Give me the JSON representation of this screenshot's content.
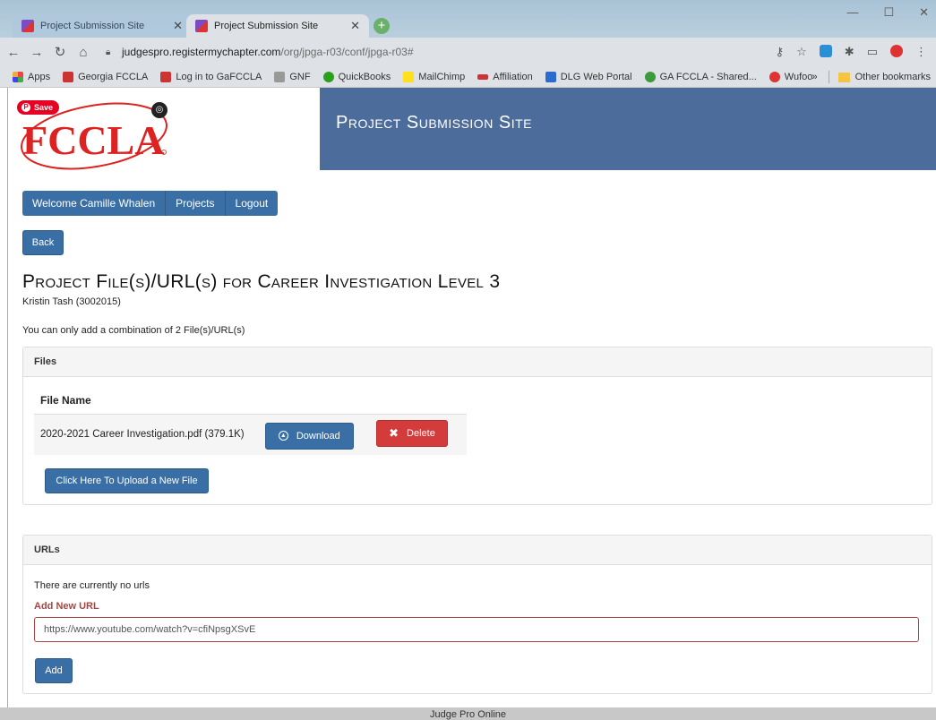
{
  "browser": {
    "tabs": [
      {
        "title": "Project Submission Site",
        "active": false
      },
      {
        "title": "Project Submission Site",
        "active": true
      }
    ],
    "new_tab": "+",
    "url_host": "judgespro.registermychapter.com",
    "url_path": "/org/jpga-r03/conf/jpga-r03#",
    "bookmarks": [
      "Apps",
      "Georgia FCCLA",
      "Log in to GaFCCLA",
      "GNF",
      "QuickBooks",
      "MailChimp",
      "Affiliation",
      "DLG Web Portal",
      "GA FCCLA - Shared...",
      "Wufoo"
    ],
    "bookmark_overflow": "»",
    "other_bookmarks": "Other bookmarks"
  },
  "header": {
    "save_label": "Save",
    "banner_title": "Project Submission Site"
  },
  "nav": {
    "welcome": "Welcome Camille Whalen",
    "projects": "Projects",
    "logout": "Logout"
  },
  "back_label": "Back",
  "page": {
    "title": "Project File(s)/URL(s) for Career Investigation Level 3",
    "student": "Kristin Tash (3002015)",
    "limit_note": "You can only add a combination of 2 File(s)/URL(s)"
  },
  "files": {
    "heading": "Files",
    "column_header": "File Name",
    "rows": [
      {
        "name": "2020-2021 Career Investigation.pdf (379.1K)",
        "download_label": "Download",
        "delete_label": "Delete"
      }
    ],
    "upload_label": "Click Here To Upload a New File"
  },
  "urls": {
    "heading": "URLs",
    "empty_message": "There are currently no urls",
    "add_label": "Add New URL",
    "input_value": "https://www.youtube.com/watch?v=cfiNpsgXSvE",
    "add_button": "Add"
  },
  "footer": "Judge Pro Online",
  "colors": {
    "primary": "#3a6fa6",
    "banner": "#4c6c9c",
    "danger": "#d43b3b",
    "error_label": "#a94442"
  }
}
